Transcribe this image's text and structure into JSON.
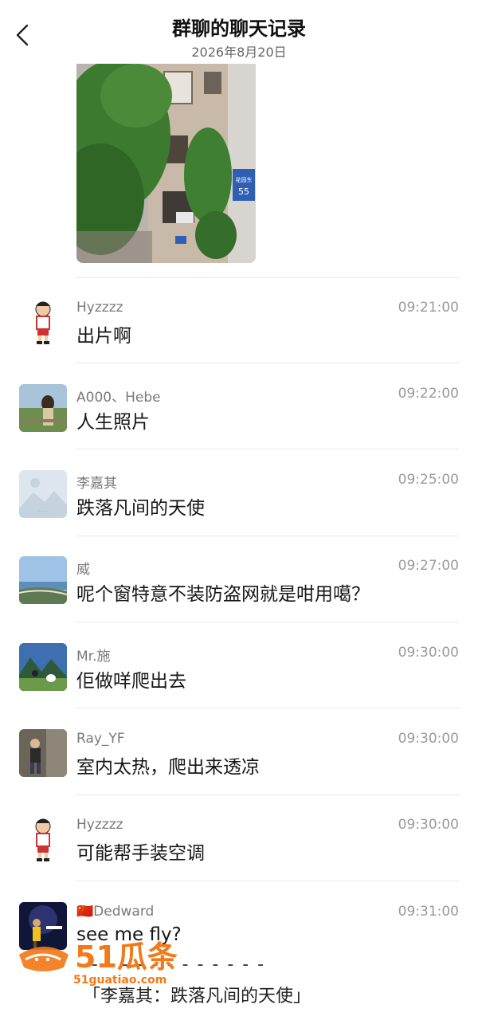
{
  "header": {
    "title": "群聊的聊天记录",
    "date": "2026年8月20日"
  },
  "messages": [
    {
      "name": "Hyzzzz",
      "time": "09:21:00",
      "text": "出片啊",
      "avatar": "cartoon-avatar"
    },
    {
      "name": "A000、Hebe",
      "time": "09:22:00",
      "text": "人生照片",
      "avatar": "photo-avatar-woman"
    },
    {
      "name": "李嘉其",
      "time": "09:25:00",
      "text": "跌落凡间的天使",
      "avatar": "placeholder-avatar"
    },
    {
      "name": "威",
      "time": "09:27:00",
      "text": "呢个窗特意不装防盗网就是咁用噶？",
      "avatar": "photo-avatar-beach"
    },
    {
      "name": "Mr.施",
      "time": "09:30:00",
      "text": "佢做咩爬出去",
      "avatar": "photo-avatar-mountain"
    },
    {
      "name": "Ray_YF",
      "time": "09:30:00",
      "text": "室内太热，爬出来透凉",
      "avatar": "photo-avatar-street"
    },
    {
      "name": "Hyzzzz",
      "time": "09:30:00",
      "text": "可能帮手装空调",
      "avatar": "cartoon-avatar"
    },
    {
      "name": "🇨🇳Dedward",
      "time": "09:31:00",
      "text": "see me fly?",
      "avatar": "photo-avatar-forever"
    }
  ],
  "quote": {
    "separator": "- - - - - - - - - - - - -",
    "text": "「李嘉其：跌落凡间的天使」"
  },
  "watermark": {
    "brand": "51瓜条",
    "url": "51guatiao.com"
  },
  "colors": {
    "name_gray": "#7a7a7a",
    "time_gray": "#9a9a9a",
    "divider": "#e8e8e8",
    "watermark_orange": "#f27a1a"
  }
}
